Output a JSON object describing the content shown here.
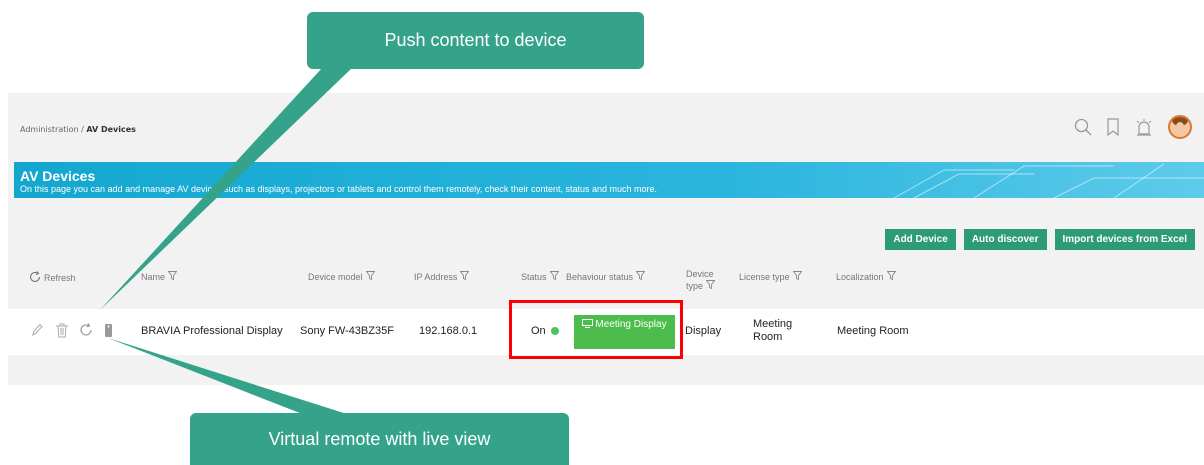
{
  "breadcrumb": {
    "parent": "Administration",
    "separator": " / ",
    "current": "AV Devices"
  },
  "banner": {
    "title": "AV Devices",
    "subtitle": "On this page you can add and manage AV devices such as displays, projectors or tablets and control them remotely, check their content, status and much more."
  },
  "buttons": {
    "add": "Add Device",
    "discover": "Auto discover",
    "import": "Import devices from Excel"
  },
  "table": {
    "refresh": "Refresh",
    "headers": {
      "name": "Name",
      "model": "Device model",
      "ip": "IP Address",
      "status": "Status",
      "behaviour": "Behaviour status",
      "type_line1": "Device",
      "type_line2": "type",
      "license": "License type",
      "localization": "Localization"
    },
    "rows": [
      {
        "name": "BRAVIA Professional Display",
        "model": "Sony FW-43BZ35F",
        "ip": "192.168.0.1",
        "status": "On",
        "behaviour": "Meeting Display",
        "type": "Display",
        "license": "Meeting Room",
        "localization": "Meeting Room"
      }
    ]
  },
  "callouts": {
    "push": "Push content to device",
    "remote": "Virtual remote with live view"
  },
  "colors": {
    "accent": "#2e9b77",
    "banner": "#13a7cf",
    "status_on": "#4cc45a",
    "behaviour_bg": "#4cbd4c",
    "highlight": "#ff0000",
    "callout": "#34a38a"
  }
}
